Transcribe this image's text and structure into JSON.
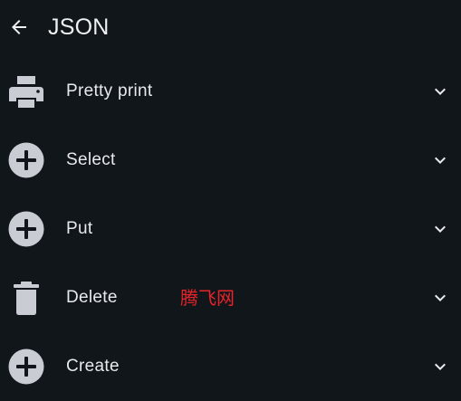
{
  "header": {
    "title": "JSON",
    "back_icon": "arrow-left-icon"
  },
  "colors": {
    "background": "#11161b",
    "text": "#e7e9ec",
    "icon": "#c9ccd3",
    "watermark": "#e8232a"
  },
  "items": [
    {
      "label": "Pretty print",
      "icon": "printer-icon",
      "chevron": "chevron-down-icon"
    },
    {
      "label": "Select",
      "icon": "plus-circle-icon",
      "chevron": "chevron-down-icon"
    },
    {
      "label": "Put",
      "icon": "plus-circle-icon",
      "chevron": "chevron-down-icon"
    },
    {
      "label": "Delete",
      "icon": "trash-icon",
      "chevron": "chevron-down-icon"
    },
    {
      "label": "Create",
      "icon": "plus-circle-icon",
      "chevron": "chevron-down-icon"
    }
  ],
  "watermark": {
    "text": "腾飞网"
  }
}
